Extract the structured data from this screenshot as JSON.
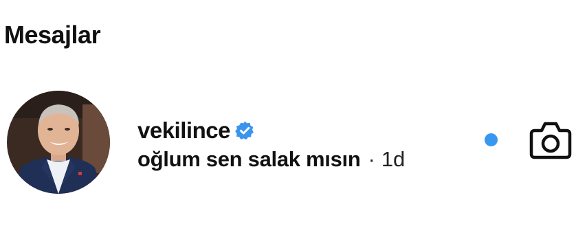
{
  "header": {
    "title": "Mesajlar"
  },
  "thread": {
    "username": "vekilince",
    "verified_icon": "verified-badge-icon",
    "preview": "oğlum sen salak mısın",
    "separator": "·",
    "time": "1d",
    "unread": true,
    "camera_icon": "camera-icon"
  },
  "colors": {
    "accent_blue": "#3897f0",
    "verified_blue": "#3b95ef",
    "text": "#111111"
  }
}
